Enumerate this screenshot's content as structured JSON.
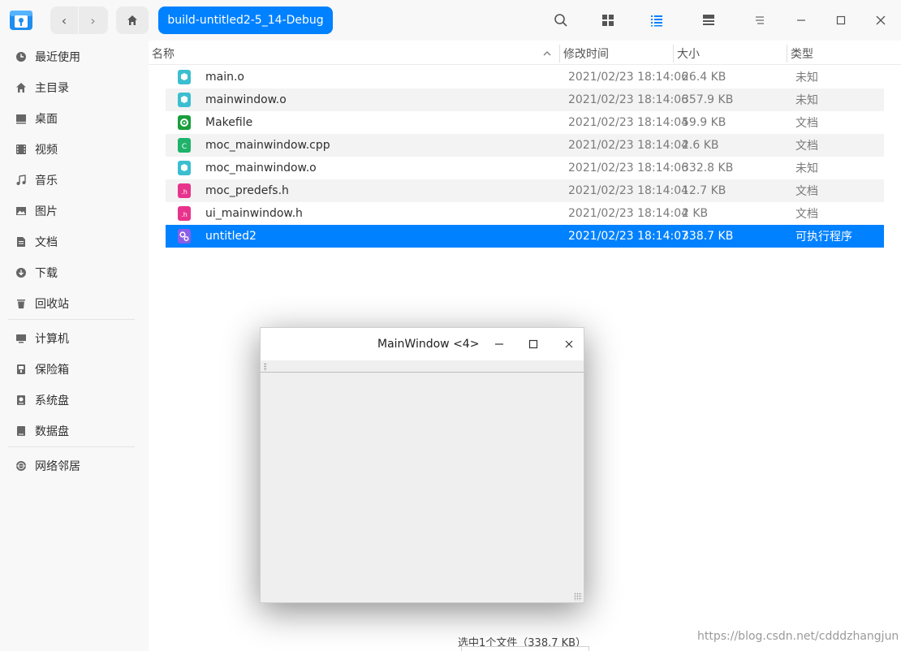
{
  "toolbar": {
    "back_glyph": "‹",
    "forward_glyph": "›",
    "breadcrumb": "build-untitled2-5_14-Debug",
    "icons": [
      "search-icon",
      "icon-view-icon",
      "list-view-icon",
      "detail-view-icon",
      "menu-icon",
      "minimize-icon",
      "maximize-icon",
      "close-icon"
    ]
  },
  "sidebar": {
    "items": [
      {
        "label": "最近使用",
        "icon": "recent-icon"
      },
      {
        "label": "主目录",
        "icon": "home-icon"
      },
      {
        "label": "桌面",
        "icon": "desktop-icon"
      },
      {
        "label": "视频",
        "icon": "video-icon"
      },
      {
        "label": "音乐",
        "icon": "music-icon"
      },
      {
        "label": "图片",
        "icon": "picture-icon"
      },
      {
        "label": "文档",
        "icon": "document-icon"
      },
      {
        "label": "下载",
        "icon": "download-icon"
      },
      {
        "label": "回收站",
        "icon": "trash-icon"
      },
      {
        "label": "计算机",
        "icon": "computer-icon"
      },
      {
        "label": "保险箱",
        "icon": "vault-icon"
      },
      {
        "label": "系统盘",
        "icon": "system-disk-icon"
      },
      {
        "label": "数据盘",
        "icon": "data-disk-icon"
      },
      {
        "label": "网络邻居",
        "icon": "network-icon"
      }
    ]
  },
  "columns": {
    "name": "名称",
    "modified": "修改时间",
    "size": "大小",
    "type": "类型"
  },
  "files": [
    {
      "name": "main.o",
      "date": "2021/02/23 18:14:06",
      "size": "26.4 KB",
      "type": "未知",
      "icon": "object-file-icon",
      "color": "#3bbfd0"
    },
    {
      "name": "mainwindow.o",
      "date": "2021/02/23 18:14:06",
      "size": "357.9 KB",
      "type": "未知",
      "icon": "object-file-icon",
      "color": "#3bbfd0"
    },
    {
      "name": "Makefile",
      "date": "2021/02/23 18:14:04",
      "size": "59.9 KB",
      "type": "文档",
      "icon": "makefile-icon",
      "color": "#1a9e3c"
    },
    {
      "name": "moc_mainwindow.cpp",
      "date": "2021/02/23 18:14:04",
      "size": "2.6 KB",
      "type": "文档",
      "icon": "cpp-file-icon",
      "color": "#1fb26a"
    },
    {
      "name": "moc_mainwindow.o",
      "date": "2021/02/23 18:14:06",
      "size": "332.8 KB",
      "type": "未知",
      "icon": "object-file-icon",
      "color": "#3bbfd0"
    },
    {
      "name": "moc_predefs.h",
      "date": "2021/02/23 18:14:04",
      "size": "12.7 KB",
      "type": "文档",
      "icon": "header-file-icon",
      "color": "#e8338c"
    },
    {
      "name": "ui_mainwindow.h",
      "date": "2021/02/23 18:14:04",
      "size": "2 KB",
      "type": "文档",
      "icon": "header-file-icon",
      "color": "#e8338c"
    },
    {
      "name": "untitled2",
      "date": "2021/02/23 18:14:07",
      "size": "338.7 KB",
      "type": "可执行程序",
      "icon": "executable-icon",
      "color": "#8a5ee8",
      "selected": true
    }
  ],
  "status": "选中1个文件（338.7 KB）",
  "watermark": "https://blog.csdn.net/cdddzhangjun",
  "floating_window": {
    "title": "MainWindow <4>"
  },
  "colors": {
    "accent": "#0081ff",
    "selection": "#0081ff"
  }
}
